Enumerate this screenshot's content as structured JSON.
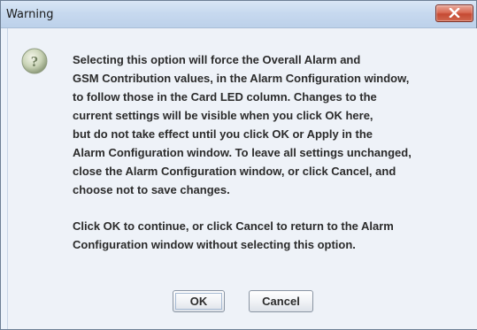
{
  "window": {
    "title": "Warning"
  },
  "icon": "question-icon",
  "message": {
    "paragraph1_lines": [
      "Selecting this option will force the Overall Alarm and",
      "GSM Contribution values, in the Alarm Configuration window,",
      "to follow those in the Card LED column. Changes to the",
      "current settings will be visible when you click OK here,",
      "but do not take effect until you click OK or Apply in the",
      "Alarm Configuration window. To leave all settings unchanged,",
      "close the Alarm Configuration window, or click Cancel, and",
      "choose not to save changes."
    ],
    "paragraph2_lines": [
      "Click OK to continue, or click Cancel to return to the Alarm",
      "Configuration window without selecting this option."
    ]
  },
  "buttons": {
    "ok_label": "OK",
    "cancel_label": "Cancel"
  },
  "colors": {
    "close_button": "#d96b55",
    "titlebar": "#c7d9ef",
    "background": "#eef2f8"
  }
}
